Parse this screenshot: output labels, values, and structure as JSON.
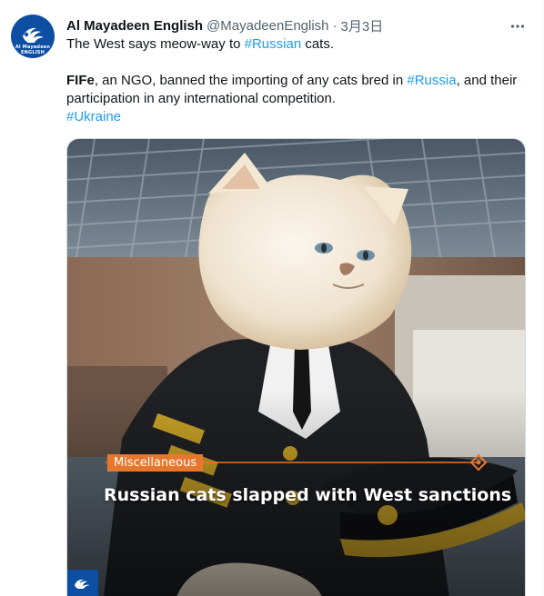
{
  "tweet": {
    "display_name": "Al Mayadeen English",
    "handle": "@MayadeenEnglish",
    "separator": "·",
    "time": "3月3日",
    "line1": {
      "before": "The West says meow-way to ",
      "hashtag": "#Russian",
      "after": " cats."
    },
    "line2": {
      "bold": "FIFe",
      "before": ", an NGO, banned the importing of any cats bred in ",
      "hashtag": "#Russia",
      "after": ", and their participation in any international competition."
    },
    "line3_hashtag": "#Ukraine"
  },
  "avatar": {
    "brand": "Al Mayadeen",
    "sub": "ENGLISH"
  },
  "media": {
    "tag": "Miscellaneous",
    "headline": "Russian cats slapped with West sanctions"
  },
  "icons": {
    "more": "more-horizontal-icon",
    "logo": "al-mayadeen-logo-icon"
  },
  "colors": {
    "accent": "#1d9bf0",
    "tag": "#e8772e",
    "brand": "#0b4ea2"
  }
}
